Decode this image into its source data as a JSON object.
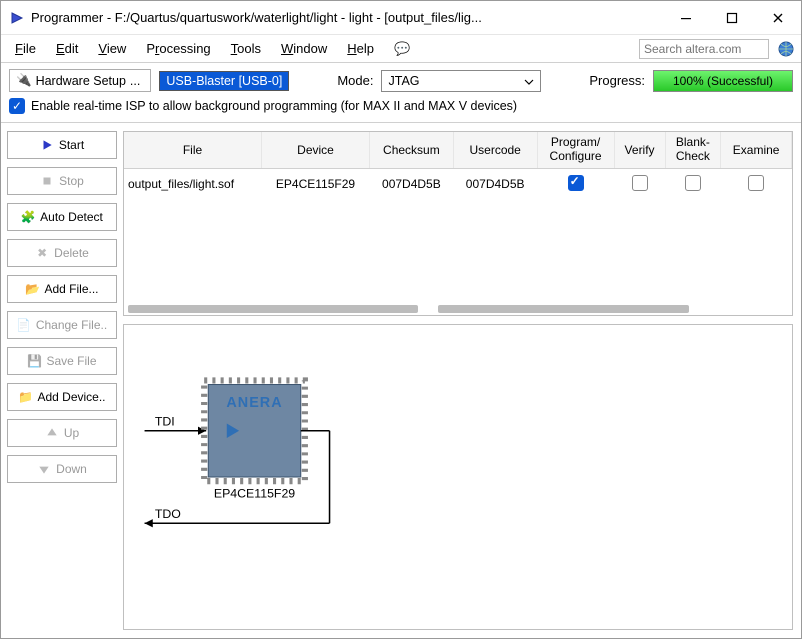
{
  "window": {
    "title": "Programmer - F:/Quartus/quartuswork/waterlight/light - light - [output_files/lig..."
  },
  "menu": {
    "file": "File",
    "edit": "Edit",
    "view": "View",
    "processing": "Processing",
    "tools": "Tools",
    "window": "Window",
    "help": "Help"
  },
  "search": {
    "placeholder": "Search altera.com"
  },
  "toolbar": {
    "hardware_setup": "Hardware Setup",
    "current_hw": "USB-Blaster [USB-0]",
    "mode_label": "Mode:",
    "mode_value": "JTAG",
    "progress_label": "Progress:",
    "progress_text": "100% (Successful)"
  },
  "realtime_isp": {
    "label": "Enable real-time ISP to allow background programming (for MAX II and MAX V devices)",
    "checked": true
  },
  "buttons": {
    "start": "Start",
    "stop": "Stop",
    "auto_detect": "Auto Detect",
    "delete": "Delete",
    "add_file": "Add File...",
    "change_file": "Change File..",
    "save_file": "Save File",
    "add_device": "Add Device..",
    "up": "Up",
    "down": "Down"
  },
  "table": {
    "headers": {
      "file": "File",
      "device": "Device",
      "checksum": "Checksum",
      "usercode": "Usercode",
      "program": "Program/\nConfigure",
      "verify": "Verify",
      "blankcheck": "Blank-\nCheck",
      "examine": "Examine"
    },
    "rows": [
      {
        "file": "output_files/light.sof",
        "device": "EP4CE115F29",
        "checksum": "007D4D5B",
        "usercode": "007D4D5B",
        "program": true,
        "verify": false,
        "blankcheck": false,
        "examine": false
      }
    ]
  },
  "diagram": {
    "tdi": "TDI",
    "tdo": "TDO",
    "chip_label": "EP4CE115F29",
    "chip_logo": "ANERA"
  }
}
